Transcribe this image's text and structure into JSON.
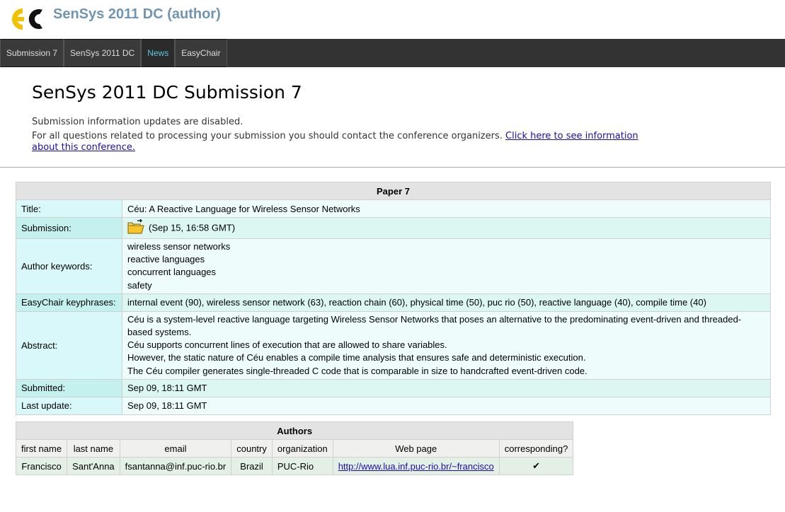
{
  "app": {
    "title": "SenSys 2011 DC (author)"
  },
  "menu": [
    {
      "label": "Submission 7",
      "active": false
    },
    {
      "label": "SenSys 2011 DC",
      "active": false
    },
    {
      "label": "News",
      "active": true
    },
    {
      "label": "EasyChair",
      "active": false
    }
  ],
  "page": {
    "title": "SenSys 2011 DC Submission 7",
    "notice": "Submission information updates are disabled.",
    "contact_text": "For all questions related to processing your submission you should contact the conference organizers. ",
    "contact_link": "Click here to see information about this conference."
  },
  "paper": {
    "caption": "Paper 7",
    "title_label": "Title:",
    "title_value": "Céu: A Reactive Language for Wireless Sensor Networks",
    "submission_label": "Submission:",
    "submission_value": "(Sep 15, 16:58 GMT)",
    "keywords_label": "Author keywords:",
    "keywords": [
      "wireless sensor networks",
      "reactive languages",
      "concurrent languages",
      "safety"
    ],
    "keyphrases_label": "EasyChair keyphrases:",
    "keyphrases_value": "internal event (90), wireless sensor network (63), reaction chain (60), physical time (50), puc rio (50), reactive language (40), compile time (40)",
    "abstract_label": "Abstract:",
    "abstract": [
      "Céu is a system-level reactive language targeting Wireless Sensor Networks that poses an alternative to the predominating event-driven and threaded-based systems.",
      "Céu supports concurrent lines of execution that are allowed to share variables.",
      "However, the static nature of Céu enables a compile time analysis that ensures safe and deterministic execution.",
      "The Céu compiler generates single-threaded C code that is comparable in size to handcrafted event-driven code."
    ],
    "submitted_label": "Submitted:",
    "submitted_value": "Sep 09, 18:11 GMT",
    "updated_label": "Last update:",
    "updated_value": "Sep 09, 18:11 GMT"
  },
  "authors": {
    "caption": "Authors",
    "headers": [
      "first name",
      "last name",
      "email",
      "country",
      "organization",
      "Web page",
      "corresponding?"
    ],
    "rows": [
      {
        "first": "Francisco",
        "last": "Sant'Anna",
        "email": "fsantanna@inf.puc-rio.br",
        "country": "Brazil",
        "organization": "PUC-Rio",
        "web": "http://www.lua.inf.puc-rio.br/~francisco",
        "corresponding": "✔"
      }
    ]
  },
  "icons": {
    "logo": "easychair-logo",
    "submission_file": "folder-icon"
  },
  "colors": {
    "title": "#6f95b0",
    "menubar": "#333333",
    "active_menu": "#58c8e0",
    "link": "#1a0dab"
  }
}
